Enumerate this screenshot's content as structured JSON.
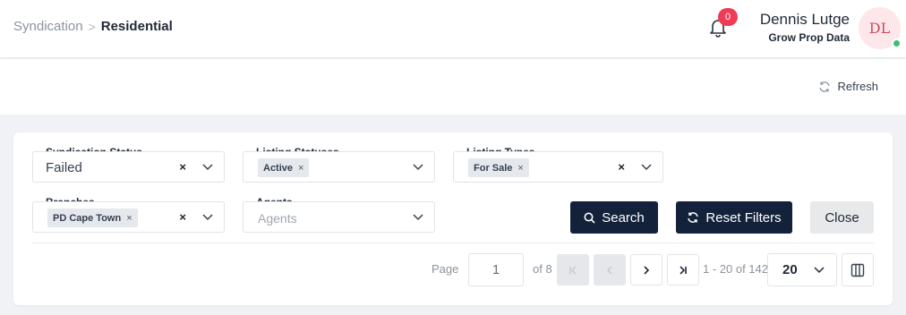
{
  "breadcrumb": {
    "parent": "Syndication",
    "current": "Residential"
  },
  "notifications": {
    "count": "0"
  },
  "user": {
    "name": "Dennis Lutge",
    "organization": "Grow Prop Data",
    "initials": "DL",
    "status_color": "#3fbf6a"
  },
  "toolbar": {
    "refresh_label": "Refresh"
  },
  "filters": {
    "syndication_status": {
      "label": "Syndication Status",
      "value": "Failed",
      "clear": "×"
    },
    "listing_statuses": {
      "label": "Listing Statuses",
      "chips": [
        "Active"
      ]
    },
    "listing_types": {
      "label": "Listing Types",
      "chips": [
        "For Sale"
      ],
      "clear": "×"
    },
    "branches": {
      "label": "Branches",
      "chips": [
        "PD Cape Town"
      ],
      "clear": "×"
    },
    "agents": {
      "label": "Agents",
      "placeholder": "Agents"
    }
  },
  "actions": {
    "search_label": "Search",
    "reset_label": "Reset Filters",
    "close_label": "Close"
  },
  "pagination": {
    "page_label": "Page",
    "current_page": "1",
    "of_label": "of 8",
    "range_text": "1 - 20 of 142",
    "page_size": "20"
  },
  "colors": {
    "primary": "#13223a",
    "badge": "#ef3b55",
    "avatar_bg": "#fde7ea",
    "avatar_text": "#d0485c"
  }
}
